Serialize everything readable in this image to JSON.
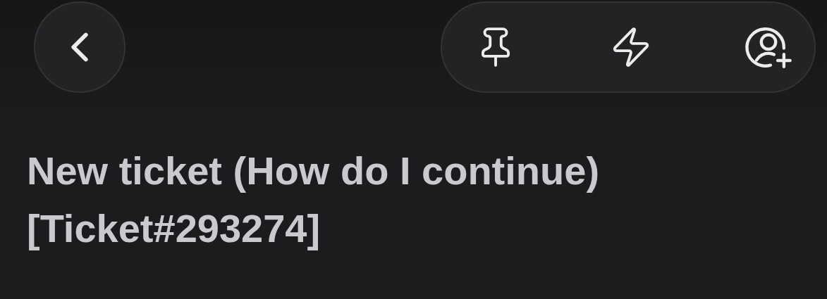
{
  "header": {
    "buttons": [
      {
        "kind": "back"
      },
      {
        "kind": "pin"
      },
      {
        "kind": "bolt"
      },
      {
        "kind": "assign"
      }
    ]
  },
  "title": "New ticket (How do I continue) [Ticket#293274]"
}
